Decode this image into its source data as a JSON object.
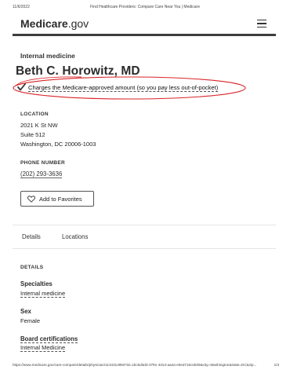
{
  "print_header": {
    "date": "11/6/2022",
    "page_title": "Find Healthcare Providers: Compare Care Near You | Medicare"
  },
  "site": {
    "logo_bold": "Medicare",
    "logo_rest": ".gov",
    "menu_icon": "hamburger-menu-icon"
  },
  "provider": {
    "specialty": "Internal medicine",
    "name": "Beth C. Horowitz, MD",
    "approved_amount": "Charges the Medicare-approved amount (so you pay less out-of-pocket)",
    "check_icon": "checkmark-icon",
    "highlight_color": "#d9252a"
  },
  "location": {
    "label": "LOCATION",
    "line1": "2021 K St NW",
    "line2": "Suite 512",
    "line3": "Washington, DC 20006-1003"
  },
  "phone": {
    "label": "PHONE NUMBER",
    "number": "(202) 293-3636"
  },
  "favorites": {
    "label": "Add to Favorites",
    "icon": "heart-icon"
  },
  "tabs": [
    {
      "label": "Details"
    },
    {
      "label": "Locations"
    }
  ],
  "details": {
    "heading": "DETAILS",
    "specialties_label": "Specialties",
    "specialties_value": "Internal medicine",
    "sex_label": "Sex",
    "sex_value": "Female",
    "board_label": "Board certifications",
    "board_value": "Internal Medicine"
  },
  "print_footer": {
    "url": "https://www.medicare.gov/care-compare/details/physician/1134314950?id=1bc5d3d3-3791-4313-aa2a-e0ed715ceb09&city=Washington&state=DC&zip...",
    "page": "1/3"
  }
}
